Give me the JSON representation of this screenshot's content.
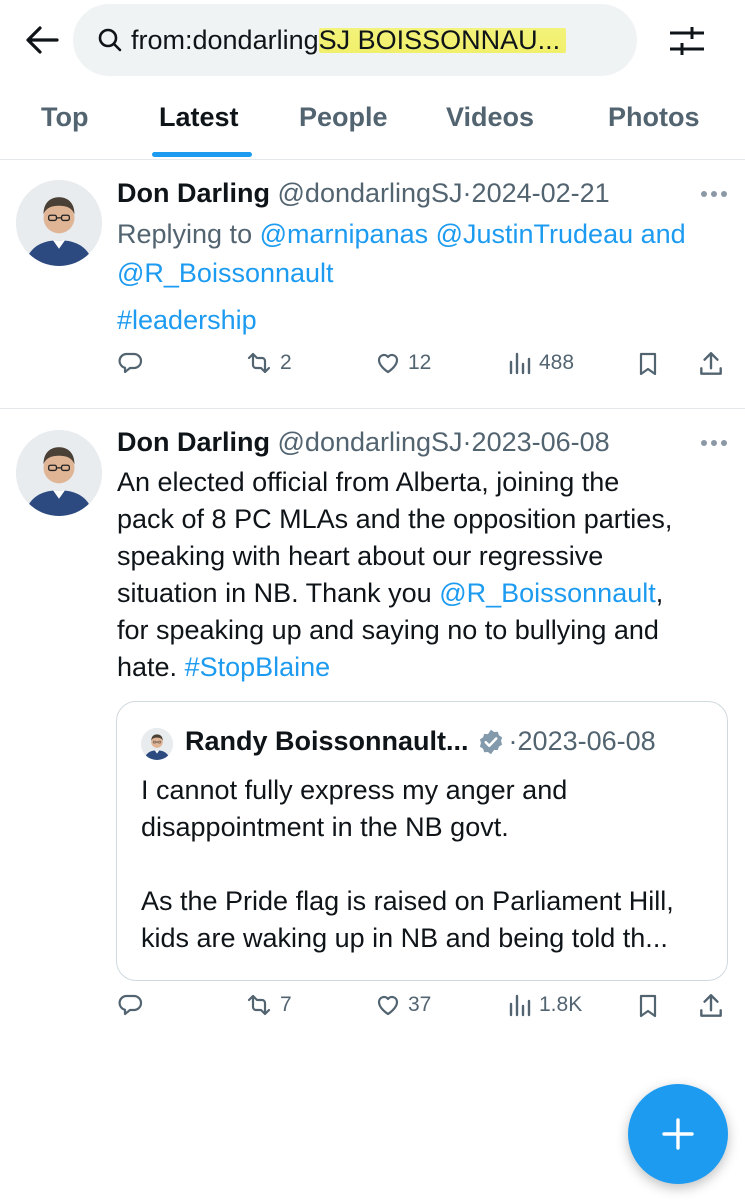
{
  "search": {
    "query_prefix": "from:dondarling",
    "query_highlight": "SJ BOISSONNAU..."
  },
  "tabs": [
    {
      "label": "Top"
    },
    {
      "label": "Latest"
    },
    {
      "label": "People"
    },
    {
      "label": "Videos"
    },
    {
      "label": "Photos"
    }
  ],
  "active_tab": "Latest",
  "tweets": [
    {
      "name": "Don Darling",
      "handle": "@dondarlingSJ",
      "sep": "·",
      "date": "2024-02-21",
      "replying_label": "Replying to",
      "replying_to": "@marnipanas @JustinTrudeau and",
      "replying_to_2": "@R_Boissonnault",
      "hashtag": "#leadership",
      "retweets": "2",
      "likes": "12",
      "views": "488"
    },
    {
      "name": "Don Darling",
      "handle": "@dondarlingSJ",
      "sep": "·",
      "date": "2023-06-08",
      "lines": [
        "An elected official from Alberta, joining the",
        "pack of 8 PC MLAs and the opposition parties,",
        "speaking with heart about our regressive",
        "situation in NB. Thank you"
      ],
      "mention": "@R_Boissonnault",
      "after_mention": ",",
      "line5": "for speaking up and saying no to bullying and",
      "line6_text": "hate.",
      "line6_hashtag": "#StopBlaine",
      "quote": {
        "name": "Randy Boissonnault...",
        "sep": "·",
        "date": "2023-06-08",
        "lines": [
          "I cannot fully express my anger and",
          "disappointment in the NB govt.",
          "",
          "As the Pride flag is raised on Parliament Hill,",
          "kids are waking up in NB and being told th..."
        ]
      },
      "retweets": "7",
      "likes": "37",
      "views": "1.8K"
    }
  ],
  "colors": {
    "accent": "#1d9bf0",
    "muted": "#536471",
    "text": "#0f1419",
    "highlight": "#f1f06b"
  },
  "icons": [
    "back-arrow-icon",
    "search-icon",
    "sliders-icon",
    "more-icon",
    "reply-icon",
    "retweet-icon",
    "like-icon",
    "views-icon",
    "bookmark-icon",
    "share-icon",
    "verified-icon",
    "plus-icon"
  ]
}
